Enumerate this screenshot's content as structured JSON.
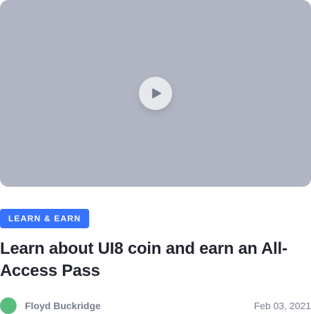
{
  "video": {
    "play_icon": "play-icon",
    "background_color": "#b1b5c3"
  },
  "tag": {
    "label": "LEARN & EARN",
    "color": "#3772ff"
  },
  "article": {
    "title": "Learn about UI8 coin and earn an All-Access Pass"
  },
  "author": {
    "name": "Floyd Buckridge",
    "avatar_color": "#58bd7d"
  },
  "date": "Feb 03, 2021"
}
